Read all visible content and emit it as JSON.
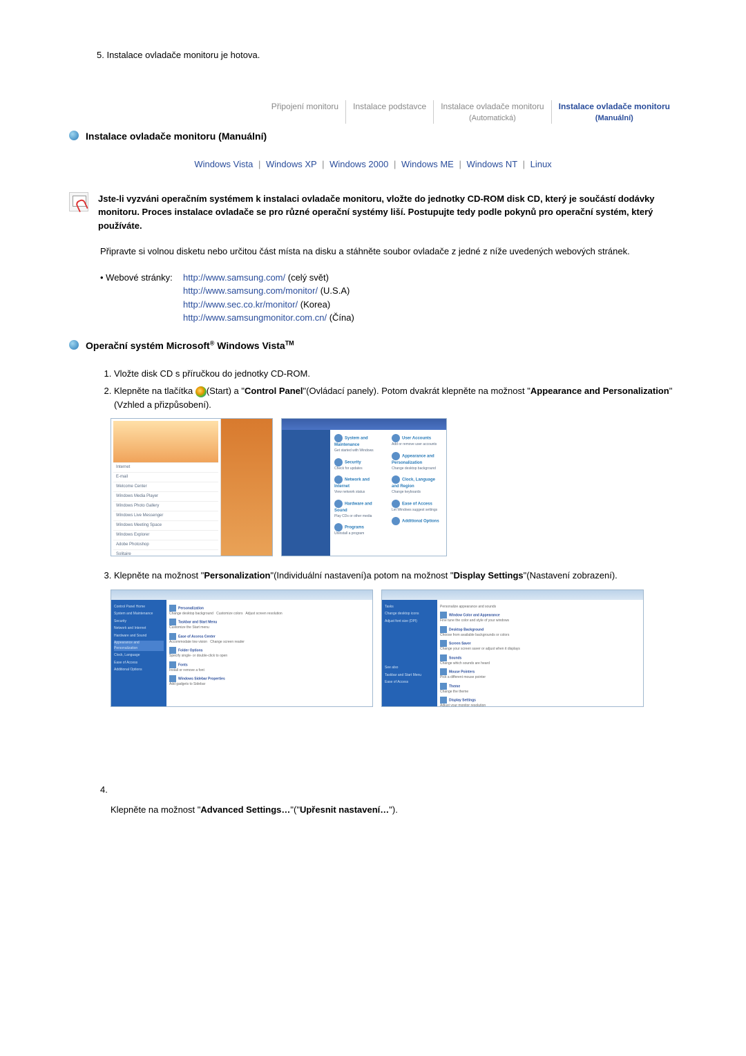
{
  "top_line": "5.  Instalace ovladače monitoru je hotova.",
  "nav": {
    "items": [
      {
        "label": "Připojení monitoru",
        "sub": ""
      },
      {
        "label": "Instalace podstavce",
        "sub": ""
      },
      {
        "label": "Instalace ovladače monitoru",
        "sub": "(Automatická)"
      },
      {
        "label": "Instalace ovladače monitoru",
        "sub": "(Manuální)"
      }
    ]
  },
  "section1": {
    "title": "Instalace ovladače monitoru (Manuální)"
  },
  "os_links": {
    "vista": "Windows Vista",
    "xp": "Windows XP",
    "w2000": "Windows 2000",
    "me": "Windows ME",
    "nt": "Windows NT",
    "linux": "Linux"
  },
  "note": "Jste-li vyzváni operačním systémem k instalaci ovladače monitoru, vložte do jednotky CD-ROM disk CD, který je součástí dodávky monitoru. Proces instalace ovladače se pro různé operační systémy liší. Postupujte tedy podle pokynů pro operační systém, který používáte.",
  "prep_para": "Připravte si volnou disketu nebo určitou část místa na disku a stáhněte soubor ovladače z jedné z níže uvedených webových stránek.",
  "web": {
    "label": "Webové stránky:",
    "rows": [
      {
        "url": "http://www.samsung.com/",
        "suffix": "(celý svět)"
      },
      {
        "url": "http://www.samsung.com/monitor/",
        "suffix": "(U.S.A)"
      },
      {
        "url": "http://www.sec.co.kr/monitor/",
        "suffix": "(Korea)"
      },
      {
        "url": "http://www.samsungmonitor.com.cn/",
        "suffix": "(Čína)"
      }
    ]
  },
  "section2": {
    "title_pre": "Operační systém Microsoft",
    "title_post": " Windows Vista",
    "reg": "®",
    "tm": "TM"
  },
  "steps": {
    "s1": "Vložte disk CD s příručkou do jednotky CD-ROM.",
    "s2a": "Klepněte na tlačítka ",
    "s2b": "(Start) a \"",
    "s2c": "Control Panel",
    "s2d": "\"(Ovládací panely). Potom dvakrát klepněte na možnost \"",
    "s2e": "Appearance and Personalization",
    "s2f": "\"(Vzhled a přizpůsobení).",
    "s3a": "Klepněte na možnost \"",
    "s3b": "Personalization",
    "s3c": "\"(Individuální nastavení)a potom na možnost \"",
    "s3d": "Display Settings",
    "s3e": "\"(Nastavení zobrazení).",
    "s4num": "4.",
    "s4a": "Klepněte na možnost \"",
    "s4b": "Advanced Settings…",
    "s4c": "\"(\"",
    "s4d": "Upřesnit nastavení…",
    "s4e": "\")."
  },
  "ss_labels": {
    "startmenu": "windows-start-menu-screenshot",
    "controlpanel": "windows-control-panel-screenshot",
    "personalization1": "windows-personalization-breadcrumb-screenshot",
    "personalization2": "windows-personalization-list-screenshot"
  }
}
